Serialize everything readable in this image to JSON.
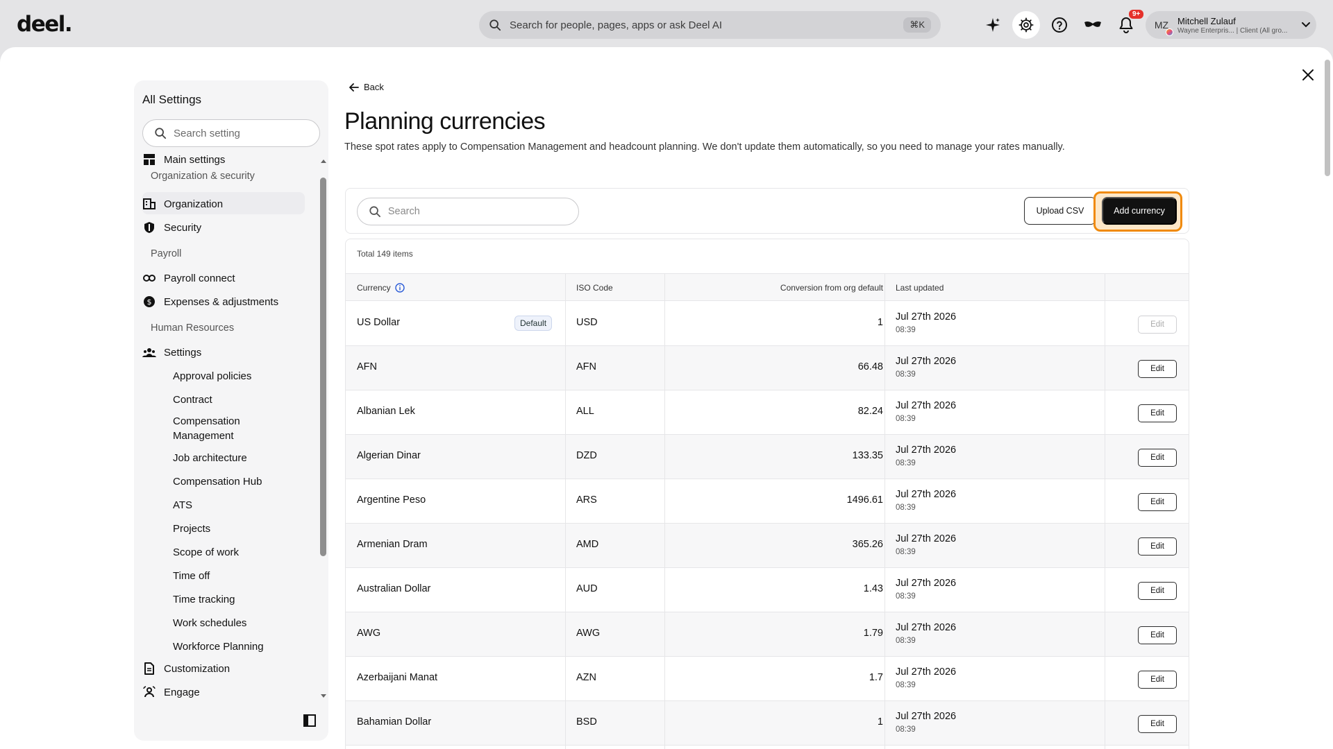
{
  "topbar": {
    "logo": "deel.",
    "search_placeholder": "Search for people, pages, apps or ask Deel AI",
    "search_shortcut": "⌘K",
    "notification_badge": "9+",
    "user": {
      "initials": "MZ",
      "name": "Mitchell Zulauf",
      "subtitle": "Wayne Enterpris... | Client (All gro..."
    }
  },
  "sidebar": {
    "title": "All Settings",
    "search_placeholder": "Search setting",
    "main_settings": "Main settings",
    "groups": {
      "org_security": "Organization & security",
      "payroll": "Payroll",
      "hr": "Human Resources"
    },
    "items": {
      "organization": "Organization",
      "security": "Security",
      "payroll_connect": "Payroll connect",
      "expenses": "Expenses & adjustments",
      "settings": "Settings",
      "customization": "Customization",
      "engage": "Engage"
    },
    "hr_subitems": [
      "Approval policies",
      "Contract",
      "Compensation Management",
      "Job architecture",
      "Compensation Hub",
      "ATS",
      "Projects",
      "Scope of work",
      "Time off",
      "Time tracking",
      "Work schedules",
      "Workforce Planning"
    ]
  },
  "page": {
    "back_label": "Back",
    "title": "Planning currencies",
    "description": "These spot rates apply to Compensation Management and headcount planning. We don't update them automatically, so you need to manage your rates manually.",
    "search_placeholder": "Search",
    "upload_label": "Upload CSV",
    "add_label": "Add currency",
    "total_label": "Total 149 items"
  },
  "table": {
    "headers": {
      "currency": "Currency",
      "iso": "ISO Code",
      "conversion": "Conversion from org default",
      "updated": "Last updated"
    },
    "default_badge": "Default",
    "edit_label": "Edit",
    "rows": [
      {
        "currency": "US Dollar",
        "iso": "USD",
        "rate": "1",
        "date": "Jul 27th 2026",
        "time": "08:39"
      },
      {
        "currency": "AFN",
        "iso": "AFN",
        "rate": "66.48",
        "date": "Jul 27th 2026",
        "time": "08:39"
      },
      {
        "currency": "Albanian Lek",
        "iso": "ALL",
        "rate": "82.24",
        "date": "Jul 27th 2026",
        "time": "08:39"
      },
      {
        "currency": "Algerian Dinar",
        "iso": "DZD",
        "rate": "133.35",
        "date": "Jul 27th 2026",
        "time": "08:39"
      },
      {
        "currency": "Argentine Peso",
        "iso": "ARS",
        "rate": "1496.61",
        "date": "Jul 27th 2026",
        "time": "08:39"
      },
      {
        "currency": "Armenian Dram",
        "iso": "AMD",
        "rate": "365.26",
        "date": "Jul 27th 2026",
        "time": "08:39"
      },
      {
        "currency": "Australian Dollar",
        "iso": "AUD",
        "rate": "1.43",
        "date": "Jul 27th 2026",
        "time": "08:39"
      },
      {
        "currency": "AWG",
        "iso": "AWG",
        "rate": "1.79",
        "date": "Jul 27th 2026",
        "time": "08:39"
      },
      {
        "currency": "Azerbaijani Manat",
        "iso": "AZN",
        "rate": "1.7",
        "date": "Jul 27th 2026",
        "time": "08:39"
      },
      {
        "currency": "Bahamian Dollar",
        "iso": "BSD",
        "rate": "1",
        "date": "Jul 27th 2026",
        "time": "08:39"
      }
    ]
  },
  "colors": {
    "accent_highlight": "#f08a0c",
    "primary_button": "#111111",
    "notification": "#e5312b"
  }
}
